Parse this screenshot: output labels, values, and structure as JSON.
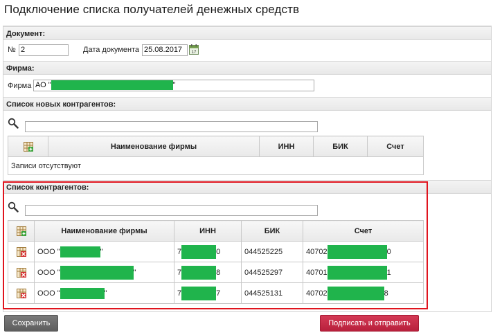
{
  "page": {
    "title": "Подключение списка получателей денежных средств"
  },
  "document_section": {
    "header": "Документ:",
    "number_label": "№",
    "number_value": "2",
    "date_label": "Дата документа",
    "date_value": "25.08.2017"
  },
  "firm_section": {
    "header": "Фирма:",
    "firm_label": "Фирма",
    "firm_prefix": "АО \"",
    "firm_suffix": "\""
  },
  "new_contractors": {
    "header": "Список новых контрагентов:",
    "search_value": "",
    "columns": [
      "Наименование фирмы",
      "ИНН",
      "БИК",
      "Счет"
    ],
    "empty_text": "Записи отсутствуют"
  },
  "contractors": {
    "header": "Список контрагентов:",
    "search_value": "",
    "columns": [
      "Наименование фирмы",
      "ИНН",
      "БИК",
      "Счет"
    ],
    "rows": [
      {
        "name_prefix": "ООО \"",
        "name_suffix": "\"",
        "inn_prefix": "7",
        "inn_suffix": "0",
        "bik": "044525225",
        "account_prefix": "40702",
        "account_suffix": "0"
      },
      {
        "name_prefix": "ООО \"",
        "name_suffix": "\"",
        "inn_prefix": "7",
        "inn_suffix": "8",
        "bik": "044525297",
        "account_prefix": "40701",
        "account_suffix": "1"
      },
      {
        "name_prefix": "ООО \"",
        "name_suffix": "\"",
        "inn_prefix": "7",
        "inn_suffix": "7",
        "bik": "044525131",
        "account_prefix": "40702",
        "account_suffix": "8"
      }
    ]
  },
  "buttons": {
    "save": "Сохранить",
    "sign_send": "Подписать и отправить"
  },
  "colors": {
    "redaction": "#20b44c",
    "highlight_frame": "#e0141e",
    "primary_button": "#c22b46",
    "secondary_button": "#6b6b6b"
  }
}
